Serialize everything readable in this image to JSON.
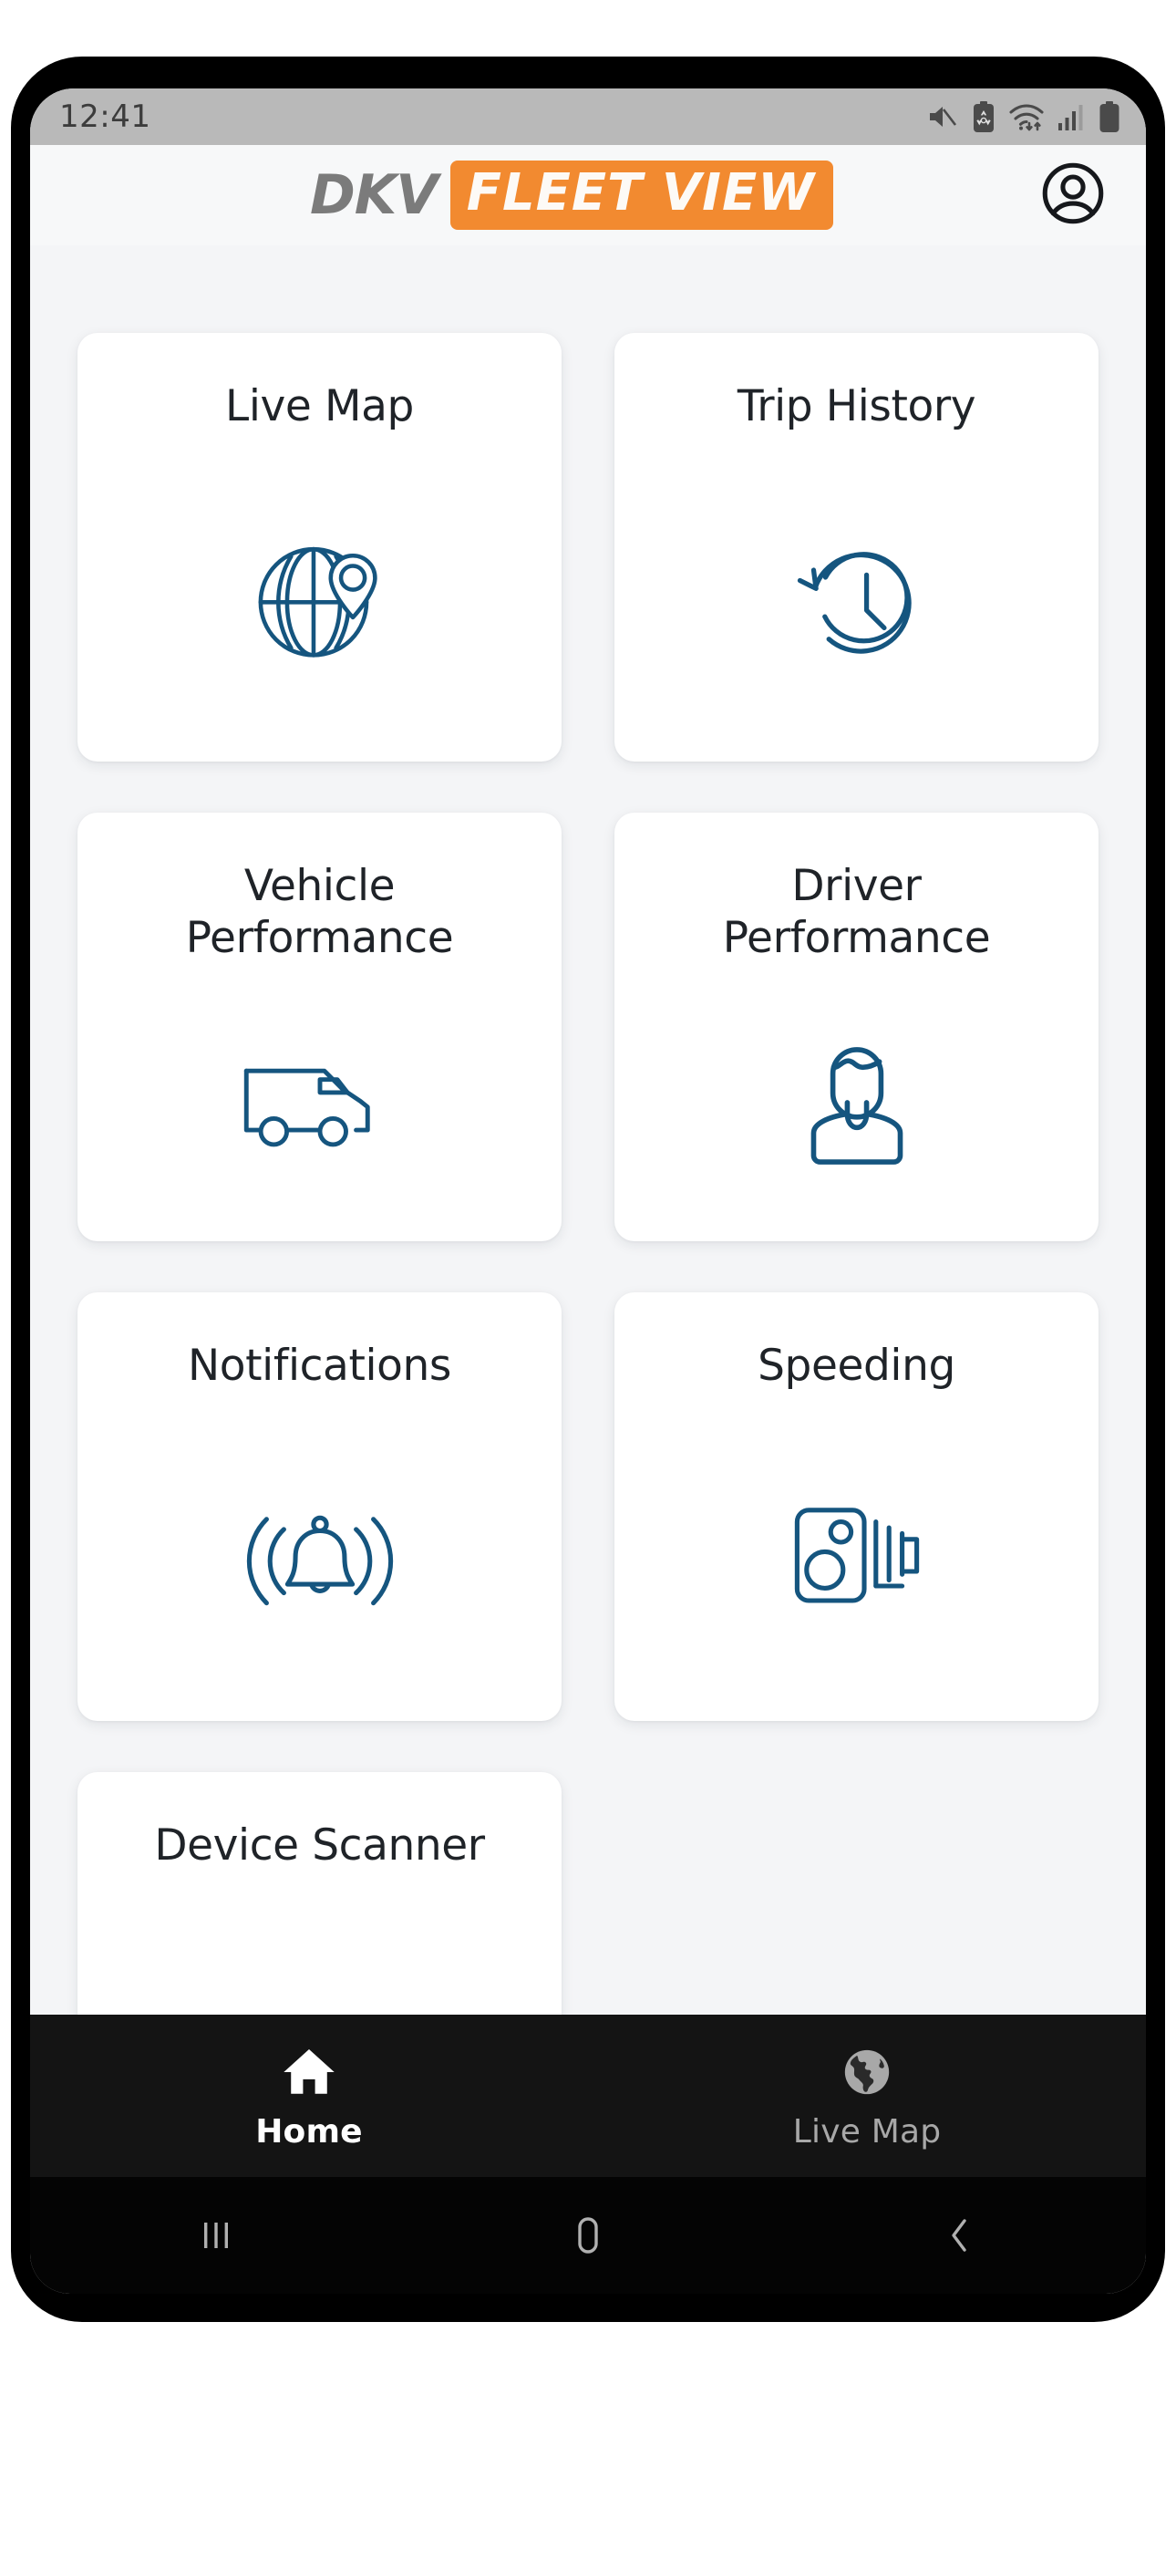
{
  "status_bar": {
    "time": "12:41",
    "icons": [
      {
        "name": "volume-mute-icon"
      },
      {
        "name": "battery-saver-icon"
      },
      {
        "name": "wifi-icon"
      },
      {
        "name": "cellular-signal-icon"
      },
      {
        "name": "battery-icon"
      }
    ]
  },
  "header": {
    "brand_primary": "DKV",
    "brand_secondary": "FLEET VIEW",
    "brand_primary_color": "#7b7b7b",
    "brand_secondary_bg": "#f28a30",
    "account_icon": "account-circle-icon"
  },
  "home": {
    "tiles": [
      {
        "label": "Live Map",
        "icon": "globe-pin-icon"
      },
      {
        "label": "Trip History",
        "icon": "clock-history-icon"
      },
      {
        "label": "Vehicle\nPerformance",
        "label_line1": "Vehicle",
        "label_line2": "Performance",
        "icon": "van-icon"
      },
      {
        "label": "Driver\nPerformance",
        "label_line1": "Driver",
        "label_line2": "Performance",
        "icon": "driver-person-icon"
      },
      {
        "label": "Notifications",
        "icon": "bell-ringing-icon"
      },
      {
        "label": "Speeding",
        "icon": "speed-camera-icon"
      },
      {
        "label": "Device Scanner",
        "icon": "device-scanner-icon"
      }
    ],
    "icon_color": "#15557f",
    "card_bg": "#ffffff",
    "page_bg": "#f4f5f7"
  },
  "bottom_nav": {
    "items": [
      {
        "label": "Home",
        "icon": "home-icon",
        "active": true
      },
      {
        "label": "Live Map",
        "icon": "earth-globe-icon",
        "active": false
      }
    ],
    "bg": "#141414",
    "active_color": "#ffffff",
    "inactive_color": "#a8a8a8"
  },
  "system_nav": {
    "buttons": [
      {
        "name": "recents-button",
        "icon": "recents-bars-icon"
      },
      {
        "name": "home-button",
        "icon": "home-square-icon"
      },
      {
        "name": "back-button",
        "icon": "chevron-left-icon"
      }
    ]
  }
}
